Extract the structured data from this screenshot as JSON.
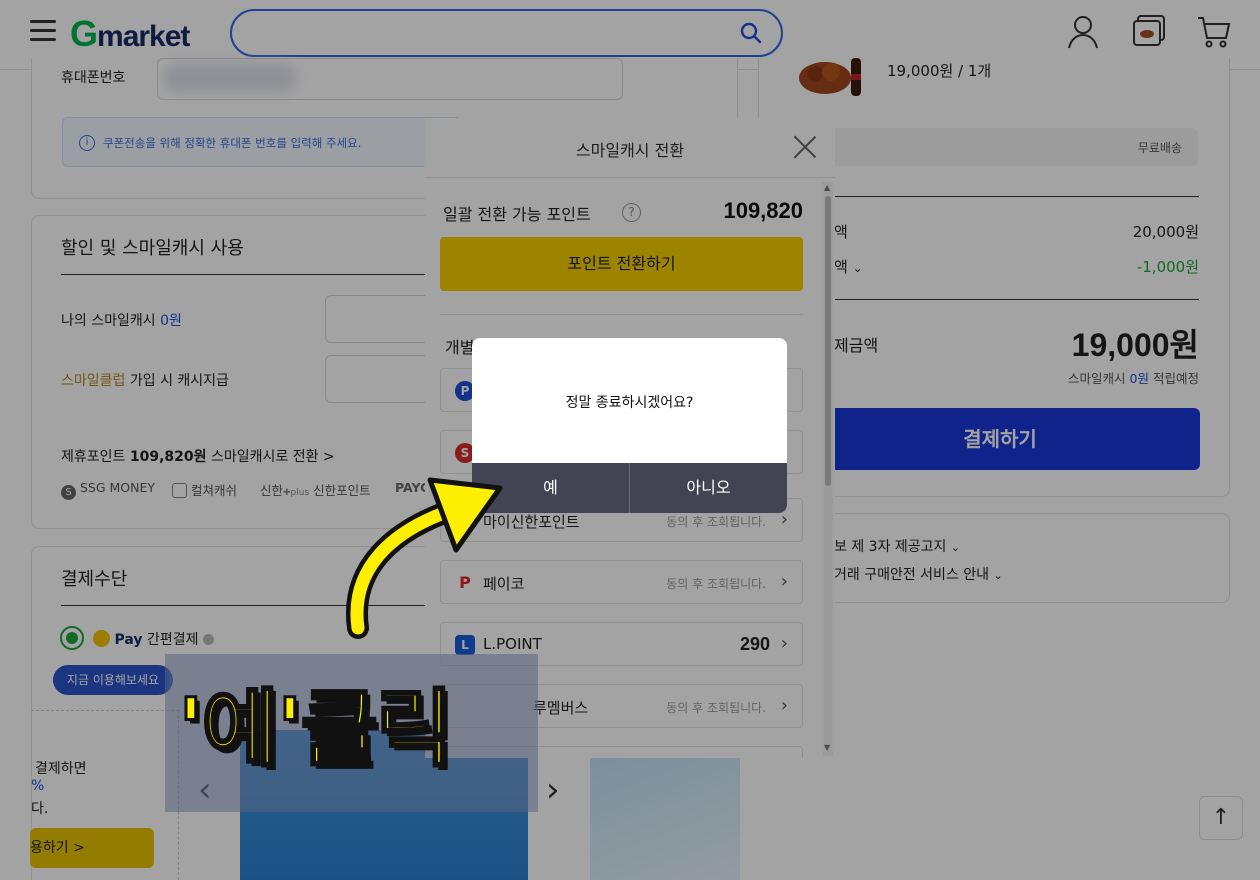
{
  "header": {
    "logo_g": "G",
    "logo_rest": "market",
    "search_placeholder": ""
  },
  "form": {
    "phone_label": "휴대폰번호",
    "phone_notice": "쿠폰전송을 위해 정확한 휴대폰 번호를 입력해 주세요."
  },
  "discount": {
    "title": "할인 및 스마일캐시 사용",
    "my_cash_label": "나의 스마일캐시",
    "my_cash_value": "0원",
    "club_label_colored": "스마일클럽",
    "club_label_rest": "가입 시 캐시지급",
    "partner_prefix": "제휴포인트",
    "partner_value": "109,820원",
    "partner_suffix": "스마일캐시로 전환 >",
    "partners": [
      "SSG MONEY",
      "컬쳐캐쉬",
      "신한",
      "신한포인트",
      "PAYC"
    ]
  },
  "payment": {
    "title": "결제수단",
    "smilepay_label": "Pay",
    "smilepay_suffix": "간편결제",
    "bubble": "지금 이용해보세요",
    "banner_text_1": "결제하면",
    "banner_text_2": "%",
    "banner_text_3": "다.",
    "banner_button": "용하기 >"
  },
  "order_summary": {
    "item_price": "19,000원 / 1개",
    "shipping": "무료배송",
    "product_amount_label": "액",
    "product_amount_value": "20,000원",
    "discount_label": "액",
    "discount_value": "-1,000원",
    "total_label": "제금액",
    "total_value": "19,000원",
    "cash_note_prefix": "스마일캐시",
    "cash_note_value": "0원",
    "cash_note_suffix": "적립예정",
    "pay_button": "결제하기",
    "policy_1": "보 제 3자 제공고지",
    "policy_2": "거래 구매안전 서비스 안내"
  },
  "smilecash_panel": {
    "title": "스마일캐시 전환",
    "available_label": "일괄 전환 가능 포인트",
    "available_value": "109,820",
    "convert_button": "포인트 전환하기",
    "individual_label": "개별 포인트 전환하기",
    "rows": [
      {
        "icon": "P",
        "name": "",
        "note": "",
        "value": ""
      },
      {
        "icon": "S",
        "name": "",
        "note": "",
        "value": ""
      },
      {
        "icon": "",
        "name": "마이신한포인트",
        "note": "동의 후 조회됩니다.",
        "value": ""
      },
      {
        "icon": "P",
        "name": "페이코",
        "note": "동의 후 조회됩니다.",
        "value": ""
      },
      {
        "icon": "L",
        "name": "L.POINT",
        "note": "",
        "value": "290"
      },
      {
        "icon": "",
        "name": "루멤버스",
        "note": "동의 후 조회됩니다.",
        "value": ""
      }
    ]
  },
  "dialog": {
    "message": "정말 종료하시겠어요?",
    "yes": "예",
    "no": "아니오"
  },
  "annotation": {
    "text": "'예'클릭"
  },
  "colors": {
    "accent_blue": "#1a37d8",
    "yellow": "#f4cf00",
    "green": "#00b24e",
    "dialog_bar": "#424454",
    "annotation_yellow": "#ffef00"
  }
}
